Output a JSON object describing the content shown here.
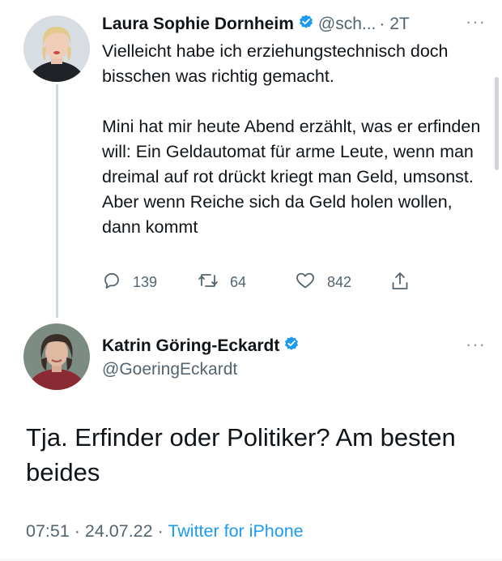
{
  "tweet1": {
    "author_name": "Laura Sophie Dornheim",
    "author_handle": "@sch...",
    "time_ago": "· 2T",
    "more": "···",
    "text": "Vielleicht habe ich erziehungstechnisch doch bisschen was richtig gemacht.\n\nMini hat mir heute Abend erzählt, was er erfinden will: Ein Geldautomat für arme Leute, wenn man dreimal auf rot drückt kriegt man Geld, umsonst.\nAber wenn Reiche sich da Geld holen wollen, dann kommt",
    "replies": "139",
    "retweets": "64",
    "likes": "842"
  },
  "tweet2": {
    "author_name": "Katrin Göring-Eckardt",
    "author_handle": "@GoeringEckardt",
    "more": "···",
    "text": "Tja. Erfinder oder Politiker? Am besten beides",
    "time": "07:51 · 24.07.22 · ",
    "source": "Twitter for iPhone"
  },
  "icons": {
    "verified": "verified-badge-icon",
    "reply": "reply-icon",
    "retweet": "retweet-icon",
    "like": "heart-icon",
    "share": "share-icon"
  },
  "colors": {
    "verified": "#1d9bf0",
    "link": "#1d9bf0",
    "muted": "#536471",
    "text": "#0f1419"
  }
}
